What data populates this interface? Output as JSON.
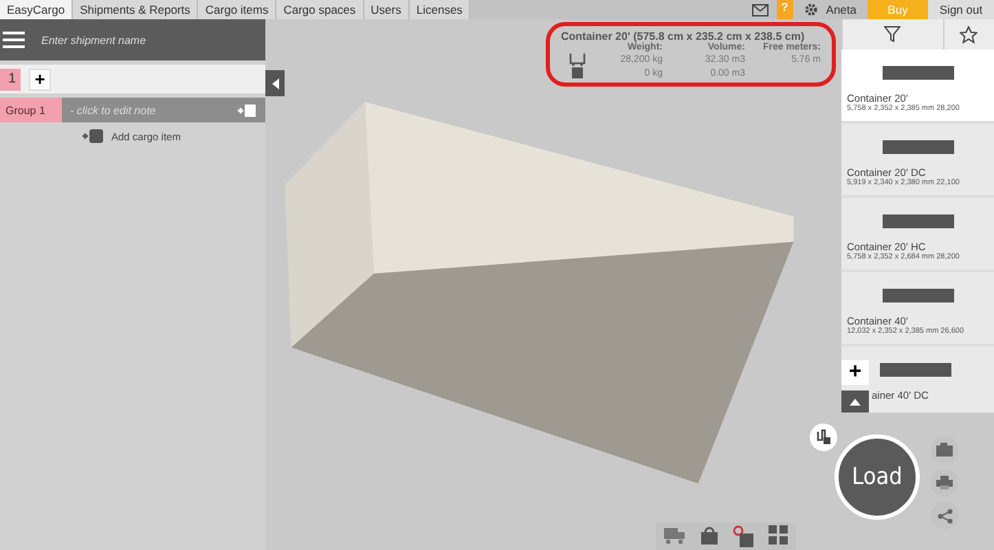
{
  "tabs": [
    {
      "label": "EasyCargo",
      "selected": true
    },
    {
      "label": "Shipments & Reports",
      "selected": false
    },
    {
      "label": "Cargo items",
      "selected": false
    },
    {
      "label": "Cargo spaces",
      "selected": false
    },
    {
      "label": "Users",
      "selected": false
    },
    {
      "label": "Licenses",
      "selected": false
    }
  ],
  "account": {
    "help": "?",
    "user": "Aneta",
    "buy": "Buy",
    "sign_out": "Sign out"
  },
  "shipment": {
    "placeholder": "Enter shipment name"
  },
  "groups_tabs": [
    {
      "label": "1",
      "selected": true
    }
  ],
  "add_group": "+",
  "groups": [
    {
      "name": "Group 1",
      "note": "- click to edit note"
    }
  ],
  "add_cargo_item": "Add cargo item",
  "info": {
    "title": "Container 20' (575.8 cm x 235.2 cm x 238.5 cm)",
    "headers": [
      "Weight:",
      "Volume:",
      "Free meters:"
    ],
    "rows": [
      {
        "kind": "capacity",
        "values": [
          "28,200 kg",
          "32.30 m3",
          "5.76 m"
        ]
      },
      {
        "kind": "loaded",
        "values": [
          "0 kg",
          "0.00 m3"
        ]
      }
    ]
  },
  "spaces": [
    {
      "name": "Container 20'",
      "dims": "5,758 x 2,352 x 2,385 mm 28,200",
      "selected": true
    },
    {
      "name": "Container 20' DC",
      "dims": "5,919 x 2,340 x 2,380 mm 22,100",
      "selected": false
    },
    {
      "name": "Container 20' HC",
      "dims": "5,758 x 2,352 x 2,684 mm 28,200",
      "selected": false
    },
    {
      "name": "Container 40'",
      "dims": "12,032 x 2,352 x 2,385 mm 26,600",
      "selected": false
    },
    {
      "name": "ainer 40' DC",
      "selected": false,
      "covered": true
    }
  ],
  "add_space": "+",
  "load_button": "Load"
}
